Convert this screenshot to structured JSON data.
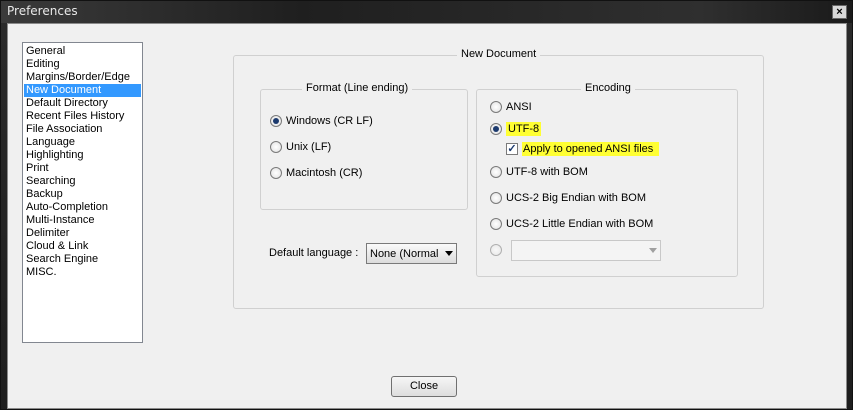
{
  "window": {
    "title": "Preferences",
    "close_glyph": "×"
  },
  "sidebar": {
    "items": [
      {
        "label": "General"
      },
      {
        "label": "Editing"
      },
      {
        "label": "Margins/Border/Edge"
      },
      {
        "label": "New Document",
        "selected": true
      },
      {
        "label": "Default Directory"
      },
      {
        "label": "Recent Files History"
      },
      {
        "label": "File Association"
      },
      {
        "label": "Language"
      },
      {
        "label": "Highlighting"
      },
      {
        "label": "Print"
      },
      {
        "label": "Searching"
      },
      {
        "label": "Backup"
      },
      {
        "label": "Auto-Completion"
      },
      {
        "label": "Multi-Instance"
      },
      {
        "label": "Delimiter"
      },
      {
        "label": "Cloud & Link"
      },
      {
        "label": "Search Engine"
      },
      {
        "label": "MISC."
      }
    ]
  },
  "main": {
    "group_title": "New Document",
    "format": {
      "title": "Format (Line ending)",
      "options": [
        {
          "label": "Windows (CR LF)",
          "checked": true
        },
        {
          "label": "Unix (LF)",
          "checked": false
        },
        {
          "label": "Macintosh (CR)",
          "checked": false
        }
      ]
    },
    "default_language": {
      "label": "Default language :",
      "value": "None (Normal"
    },
    "encoding": {
      "title": "Encoding",
      "ansi": "ANSI",
      "utf8": "UTF-8",
      "apply_ansi": "Apply to opened ANSI files",
      "apply_ansi_checked": true,
      "utf8_bom": "UTF-8 with BOM",
      "ucs2_be": "UCS-2 Big Endian with BOM",
      "ucs2_le": "UCS-2 Little Endian with BOM",
      "other_value": "",
      "selected": "utf8"
    }
  },
  "footer": {
    "close_label": "Close"
  },
  "colors": {
    "highlight": "#ffff33",
    "selection": "#3399ff"
  }
}
